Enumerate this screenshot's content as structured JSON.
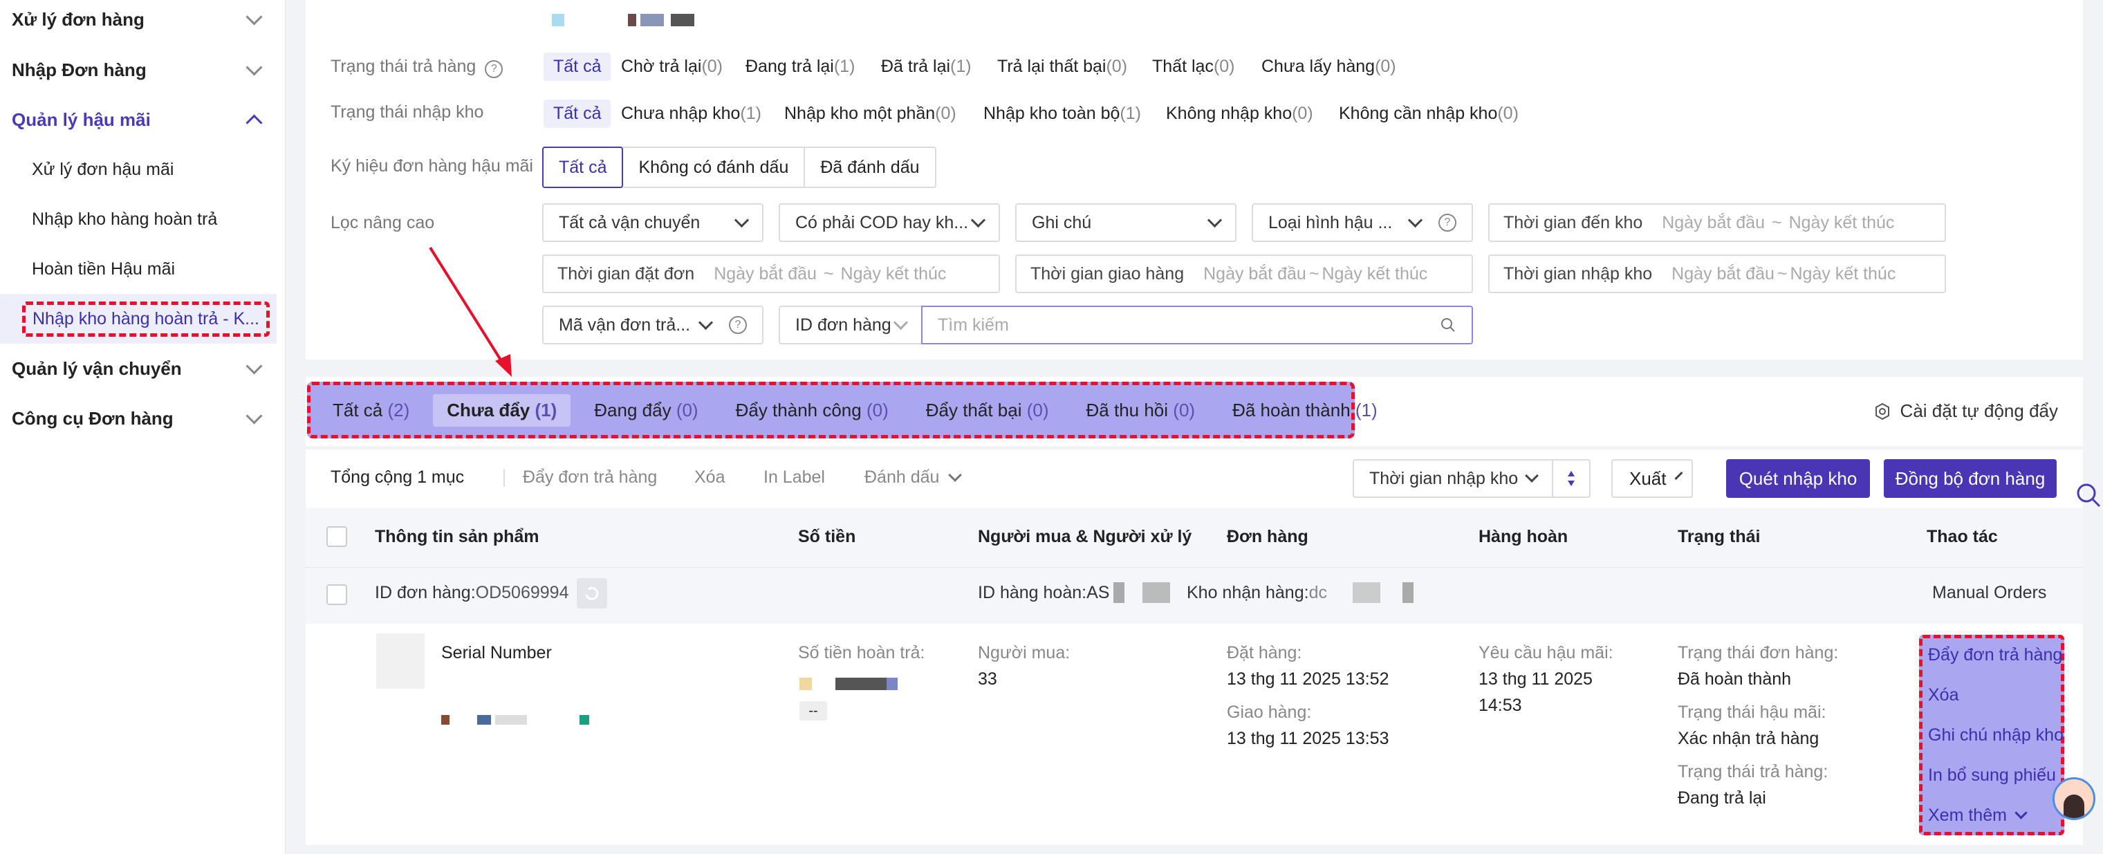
{
  "sidebar": {
    "groups": [
      {
        "label": "Xử lý đơn hàng"
      },
      {
        "label": "Nhập Đơn hàng"
      },
      {
        "label": "Quản lý hậu mãi"
      },
      {
        "label": "Quản lý vận chuyển"
      },
      {
        "label": "Công cụ Đơn hàng"
      }
    ],
    "items": [
      {
        "label": "Xử lý đơn hậu mãi"
      },
      {
        "label": "Nhập kho hàng hoàn trả"
      },
      {
        "label": "Hoàn tiền Hậu mãi"
      },
      {
        "label": "Nhập kho hàng hoàn trả - K..."
      }
    ]
  },
  "filters": {
    "return_status": {
      "label": "Trạng thái trả hàng",
      "options": [
        {
          "name": "Tất cả",
          "count": ""
        },
        {
          "name": "Chờ trả lại",
          "count": "(0)"
        },
        {
          "name": "Đang trả lại",
          "count": "(1)"
        },
        {
          "name": "Đã trả lại",
          "count": "(1)"
        },
        {
          "name": "Trả lại thất bại",
          "count": "(0)"
        },
        {
          "name": "Thất lạc",
          "count": "(0)"
        },
        {
          "name": "Chưa lấy hàng",
          "count": "(0)"
        }
      ]
    },
    "warehouse_status": {
      "label": "Trạng thái nhập kho",
      "options": [
        {
          "name": "Tất cả",
          "count": ""
        },
        {
          "name": "Chưa nhập kho",
          "count": "(1)"
        },
        {
          "name": "Nhập kho một phần",
          "count": "(0)"
        },
        {
          "name": "Nhập kho toàn bộ",
          "count": "(1)"
        },
        {
          "name": "Không nhập kho",
          "count": "(0)"
        },
        {
          "name": "Không cần nhập kho",
          "count": "(0)"
        }
      ]
    },
    "mark": {
      "label": "Ký hiệu đơn hàng hậu mãi",
      "options": [
        "Tất cả",
        "Không có đánh dấu",
        "Đã đánh dấu"
      ]
    },
    "advanced": {
      "label": "Lọc nâng cao",
      "shipping": "Tất cả vận chuyển",
      "cod": "Có phải COD hay kh...",
      "note": "Ghi chú",
      "type": "Loại hình hậu ...",
      "arrive_time": "Thời gian đến kho",
      "order_time": "Thời gian đặt đơn",
      "deliver_time": "Thời gian giao hàng",
      "import_time": "Thời gian nhập kho",
      "date_start": "Ngày bắt đầu",
      "date_end": "Ngày kết thúc",
      "tilde": "~",
      "tracking": "Mã vận đơn trả...",
      "order_id": "ID đơn hàng",
      "search_placeholder": "Tìm kiếm"
    }
  },
  "tabs": [
    {
      "name": "Tất cả",
      "count": "(2)"
    },
    {
      "name": "Chưa đẩy",
      "count": "(1)"
    },
    {
      "name": "Đang đẩy",
      "count": "(0)"
    },
    {
      "name": "Đẩy thành công",
      "count": "(0)"
    },
    {
      "name": "Đẩy thất bại",
      "count": "(0)"
    },
    {
      "name": "Đã thu hồi",
      "count": "(0)"
    },
    {
      "name": "Đã hoàn thành",
      "count": "(1)"
    }
  ],
  "auto_push_setting": "Cài đặt tự động đẩy",
  "toolbar": {
    "total": "Tổng cộng 1 mục",
    "push": "Đẩy đơn trả hàng",
    "delete": "Xóa",
    "print": "In Label",
    "mark": "Đánh dấu",
    "sort": "Thời gian nhập kho",
    "export": "Xuất",
    "scan": "Quét nhập kho",
    "sync": "Đồng bộ đơn hàng"
  },
  "table": {
    "headers": [
      "Thông tin sản phẩm",
      "Số tiền",
      "Người mua & Người xử lý",
      "Đơn hàng",
      "Hàng hoàn",
      "Trạng thái",
      "Thao tác"
    ],
    "order": {
      "order_id_label": "ID đơn hàng:",
      "order_id": "OD5069994",
      "return_id_label": "ID hàng hoàn:AS",
      "warehouse_label": "Kho nhận hàng:",
      "warehouse_prefix": "dc",
      "source": "Manual Orders",
      "serial": "Serial Number",
      "refund_label": "Số tiền hoàn trả:",
      "refund_dash": "--",
      "buyer_label": "Người mua:",
      "buyer": "33",
      "ordered_label": "Đặt hàng:",
      "ordered": "13 thg 11 2025 13:52",
      "delivered_label": "Giao hàng:",
      "delivered": "13 thg 11 2025 13:53",
      "aftersale_label": "Yêu cầu hậu mãi:",
      "aftersale_date": "13 thg 11 2025",
      "aftersale_time": "14:53",
      "order_status_label": "Trạng thái đơn hàng:",
      "order_status": "Đã hoàn thành",
      "aftersale_status_label": "Trạng thái hậu mãi:",
      "aftersale_status": "Xác nhận trả hàng",
      "return_status_label": "Trạng thái trả hàng:",
      "return_status": "Đang trả lại"
    },
    "actions": [
      "Đẩy đơn trả hàng",
      "Xóa",
      "Ghi chú nhập kho",
      "In bổ sung phiếu",
      "Xem thêm"
    ]
  }
}
